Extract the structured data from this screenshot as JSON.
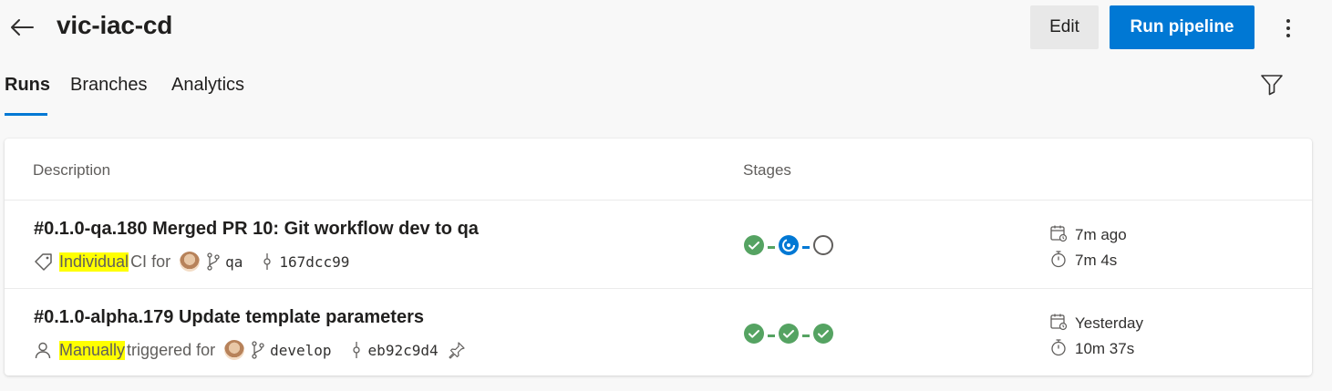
{
  "header": {
    "title": "vic-iac-cd",
    "edit_label": "Edit",
    "run_label": "Run pipeline"
  },
  "tabs": [
    "Runs",
    "Branches",
    "Analytics"
  ],
  "table": {
    "columns": {
      "description": "Description",
      "stages": "Stages"
    },
    "runs": [
      {
        "title": "#0.1.0-qa.180 Merged PR 10: Git workflow dev to qa",
        "trigger_highlight": "Individual",
        "trigger_text": "CI for",
        "branch": "qa",
        "commit": "167dcc99",
        "stage_status": [
          "succeeded",
          "running",
          "not-started"
        ],
        "when": "7m ago",
        "duration": "7m 4s"
      },
      {
        "title": "#0.1.0-alpha.179 Update template parameters",
        "trigger_highlight": "Manually",
        "trigger_text": "triggered for",
        "branch": "develop",
        "commit": "eb92c9d4",
        "stage_status": [
          "succeeded",
          "succeeded",
          "succeeded"
        ],
        "when": "Yesterday",
        "duration": "10m 37s"
      }
    ]
  },
  "colors": {
    "accent": "#0078d4",
    "success": "#55a362",
    "highlight": "#ffff00"
  },
  "icons": [
    "back-arrow-icon",
    "more-vertical-icon",
    "filter-icon",
    "tag-icon",
    "person-icon",
    "branch-icon",
    "commit-icon",
    "pin-icon",
    "calendar-icon",
    "stopwatch-icon"
  ]
}
